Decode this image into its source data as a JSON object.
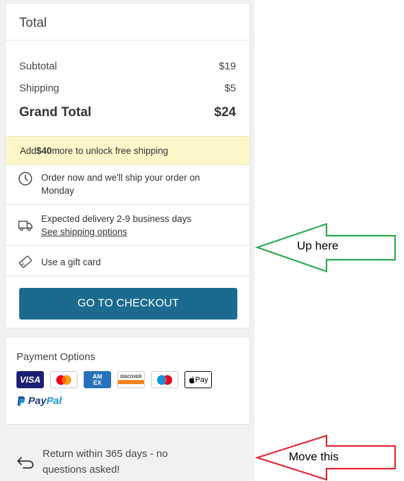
{
  "summary": {
    "title": "Total",
    "subtotal_label": "Subtotal",
    "subtotal_value": "$19",
    "shipping_label": "Shipping",
    "shipping_value": "$5",
    "grand_label": "Grand Total",
    "grand_value": "$24",
    "promo_prefix": "Add ",
    "promo_amount": "$40",
    "promo_suffix": " more to unlock free shipping",
    "ship_notice": "Order now and we'll ship your order on Monday",
    "delivery_text": "Expected delivery 2-9 business days",
    "shipping_options_link": "See shipping options",
    "gift_card_text": "Use a gift card",
    "checkout_button": "GO TO CHECKOUT"
  },
  "payment": {
    "title": "Payment Options",
    "methods": [
      "visa-icon",
      "mastercard-icon",
      "amex-icon",
      "discover-icon",
      "maestro-icon",
      "apple-pay-icon",
      "paypal-icon"
    ],
    "visa_label": "VISA",
    "amex_label": "AM EX",
    "discover_label": "DISCOVER",
    "applepay_label": "Pay",
    "paypal_part1": "Pay",
    "paypal_part2": "Pal"
  },
  "returns": {
    "line1": "Return within 365 days - no",
    "line2": "questions asked!"
  },
  "annotations": {
    "up_here": "Up here",
    "move_this": "Move this",
    "up_here_color": "#2aa84a",
    "move_this_color": "#e0252f"
  },
  "colors": {
    "checkout": "#1a6b8f",
    "promo_bg": "#fdf6c8",
    "panel_bg": "#f1f1f1"
  }
}
